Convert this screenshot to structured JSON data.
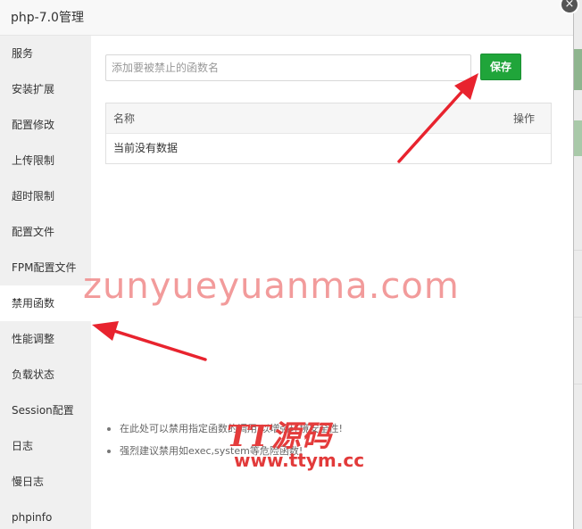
{
  "window": {
    "title": "php-7.0管理",
    "close_symbol": "×"
  },
  "sidebar": {
    "items": [
      {
        "label": "服务"
      },
      {
        "label": "安装扩展"
      },
      {
        "label": "配置修改"
      },
      {
        "label": "上传限制"
      },
      {
        "label": "超时限制"
      },
      {
        "label": "配置文件"
      },
      {
        "label": "FPM配置文件"
      },
      {
        "label": "禁用函数",
        "active": true
      },
      {
        "label": "性能调整"
      },
      {
        "label": "负载状态"
      },
      {
        "label": "Session配置"
      },
      {
        "label": "日志"
      },
      {
        "label": "慢日志"
      },
      {
        "label": "phpinfo"
      }
    ]
  },
  "main": {
    "input": {
      "placeholder": "添加要被禁止的函数名",
      "value": ""
    },
    "save_label": "保存",
    "table": {
      "headers": [
        "名称",
        "操作"
      ],
      "empty_text": "当前没有数据"
    },
    "tips": [
      "在此处可以禁用指定函数的调用,以增强环境安全性!",
      "强烈建议禁用如exec,system等危险函数!"
    ]
  },
  "overlay": {
    "watermark_text": "zunyueyuanma.com",
    "logo_main": "TT源码",
    "logo_url": "www.ttym.cc"
  },
  "colors": {
    "accent": "#20a53a",
    "annotation_red": "#e8232e"
  }
}
